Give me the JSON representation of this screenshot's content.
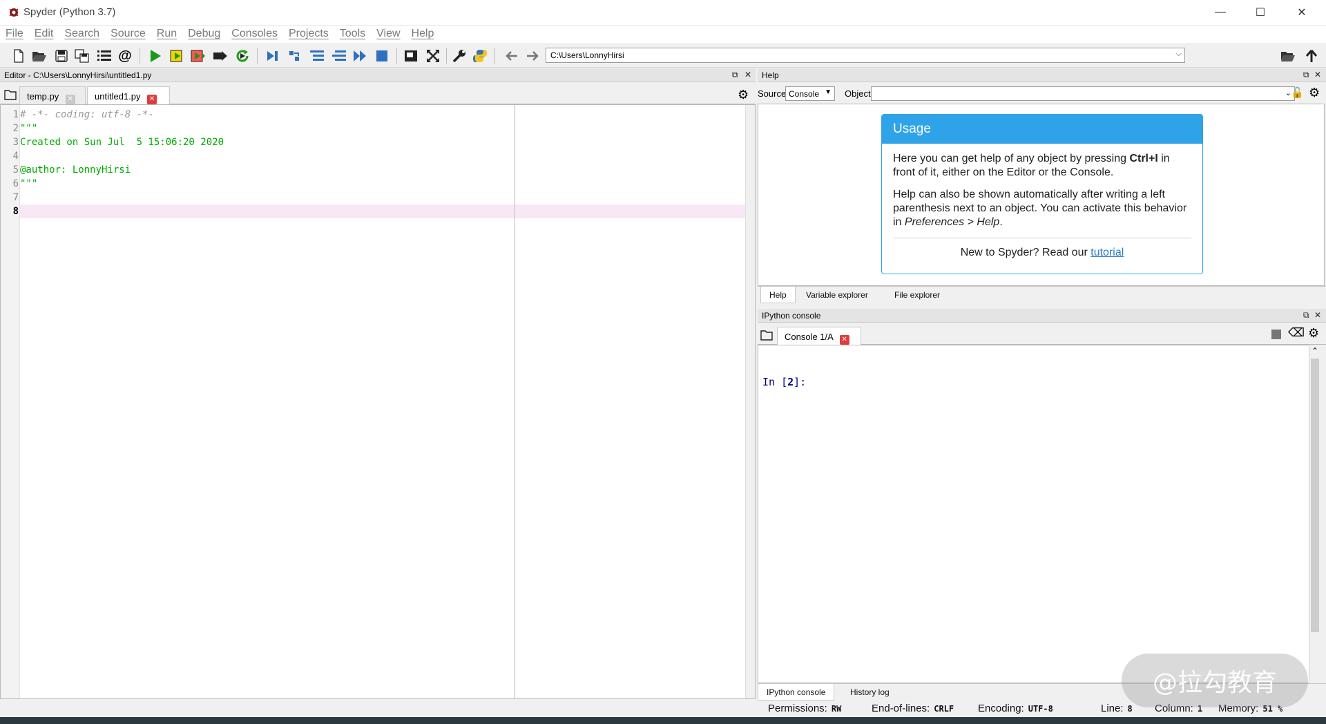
{
  "window": {
    "title": "Spyder (Python 3.7)"
  },
  "menu": [
    "File",
    "Edit",
    "Search",
    "Source",
    "Run",
    "Debug",
    "Consoles",
    "Projects",
    "Tools",
    "View",
    "Help"
  ],
  "toolbar": {
    "path": "C:\\Users\\LonnyHirsi"
  },
  "editor": {
    "header": "Editor - C:\\Users\\LonnyHirsi\\untitled1.py",
    "tabs": [
      {
        "label": "temp.py"
      },
      {
        "label": "untitled1.py"
      }
    ],
    "lines": [
      {
        "num": "1",
        "text": "# -*- coding: utf-8 -*-"
      },
      {
        "num": "2",
        "text": "\"\"\""
      },
      {
        "num": "3",
        "text": "Created on Sun Jul  5 15:06:20 2020"
      },
      {
        "num": "4",
        "text": ""
      },
      {
        "num": "5",
        "text": "@author: LonnyHirsi"
      },
      {
        "num": "6",
        "text": "\"\"\""
      },
      {
        "num": "7",
        "text": ""
      },
      {
        "num": "8",
        "text": ""
      }
    ]
  },
  "help": {
    "header": "Help",
    "source_label": "Source",
    "source_value": "Console",
    "object_label": "Object",
    "usage": {
      "title": "Usage",
      "p1_a": "Here you can get help of any object by pressing ",
      "p1_key": "Ctrl+I",
      "p1_b": " in front of it, either on the Editor or the Console.",
      "p2_a": "Help can also be shown automatically after writing a left parenthesis next to an object. You can activate this behavior in ",
      "p2_em": "Preferences > Help",
      "p2_b": ".",
      "foot": "New to Spyder? Read our ",
      "link": "tutorial"
    },
    "tabs": [
      "Help",
      "Variable explorer",
      "File explorer"
    ]
  },
  "console": {
    "header": "IPython console",
    "tab": "Console 1/A",
    "prompt_prefix": "In [",
    "prompt_num": "2",
    "prompt_suffix": "]:",
    "tabs": [
      "IPython console",
      "History log"
    ]
  },
  "status": {
    "permissions_label": "Permissions:",
    "permissions": "RW",
    "eol_label": "End-of-lines:",
    "eol": "CRLF",
    "encoding_label": "Encoding:",
    "encoding": "UTF-8",
    "line_label": "Line:",
    "line": "8",
    "column_label": "Column:",
    "column": "1",
    "memory_label": "Memory:",
    "memory": "51 %"
  },
  "watermark": "@拉勾教育",
  "colors": {
    "accent": "#2ea3e8",
    "run_green": "#1a9a1a",
    "code_string": "#00aa00",
    "code_comment": "#999999",
    "close_red": "#e03c3c",
    "prompt": "#000080"
  }
}
